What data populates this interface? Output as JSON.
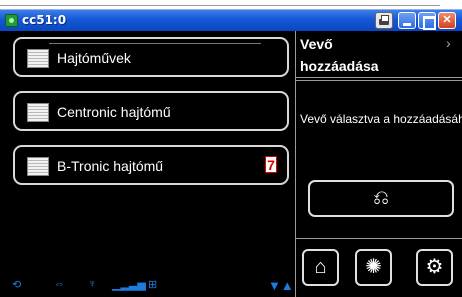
{
  "window": {
    "title": "cc51:0"
  },
  "list": {
    "items": [
      {
        "label": "Hajtóművek"
      },
      {
        "label": "Centronic hajtómű"
      },
      {
        "label": "B-Tronic hajtómű",
        "badge": "7"
      }
    ]
  },
  "right_panel": {
    "title_line1": "Vevő",
    "title_line2": "hozzáadása",
    "chevron": "›",
    "description": "Vevő választva a hozzáadásához"
  },
  "status_icons": [
    "signal-icon",
    "link-icon",
    "antenna-icon",
    "bars-icon",
    "network-icon",
    "triangles-icon"
  ],
  "colors": {
    "titlebar": "#1458d6",
    "background": "#000000",
    "badge": "#e00000",
    "status": "#1c7ce0"
  }
}
